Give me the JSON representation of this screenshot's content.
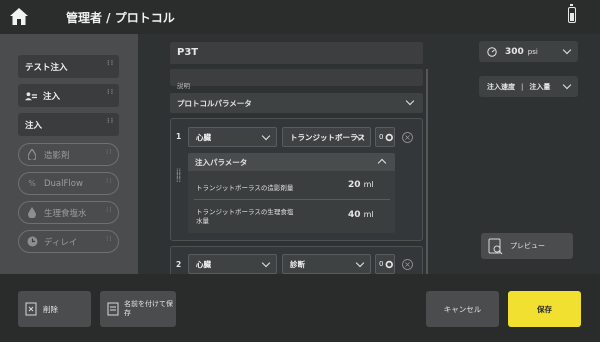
{
  "header": {
    "title": "管理者 / プロトコル",
    "home_icon": "home-icon",
    "battery_icon": "battery-icon"
  },
  "sidebar": {
    "items": [
      {
        "label": "テスト注入",
        "style": "filled"
      },
      {
        "label": "注入",
        "style": "filled",
        "icon": "patient-icon"
      },
      {
        "label": "注入",
        "style": "filled"
      },
      {
        "label": "造影剤",
        "style": "outline",
        "icon": "contrast-drop-icon"
      },
      {
        "label": "DualFlow",
        "style": "outline",
        "icon": "dualflow-icon"
      },
      {
        "label": "生理食塩水",
        "style": "outline",
        "icon": "saline-drop-icon"
      },
      {
        "label": "ディレイ",
        "style": "outline",
        "icon": "clock-icon"
      }
    ]
  },
  "main": {
    "name_value": "P3T",
    "description_placeholder": "説明",
    "protocol_params_label": "プロトコルパラメータ",
    "phases": [
      {
        "number": "1",
        "type": "心臓",
        "subtype": "トランジットボーラス",
        "count": "0",
        "injection_params": {
          "label": "注入パラメータ",
          "rows": [
            {
              "label": "トランジットボーラスの造影剤量",
              "value": "20",
              "unit": "ml"
            },
            {
              "label": "トランジットボーラスの生理食塩水量",
              "value": "40",
              "unit": "ml"
            }
          ]
        }
      },
      {
        "number": "2",
        "type": "心臓",
        "subtype": "診断",
        "count": "0"
      }
    ]
  },
  "right": {
    "pressure_value": "300",
    "pressure_unit": "psi",
    "rate_label": "注入速度",
    "volume_label": "注入量",
    "preview_label": "プレビュー"
  },
  "footer": {
    "delete_label": "削除",
    "save_as_label": "名前を付けて保存",
    "cancel_label": "キャンセル",
    "save_label": "保存"
  },
  "colors": {
    "accent_yellow": "#f2e030",
    "background": "#2f3232",
    "sidebar": "#4a4c4d"
  }
}
